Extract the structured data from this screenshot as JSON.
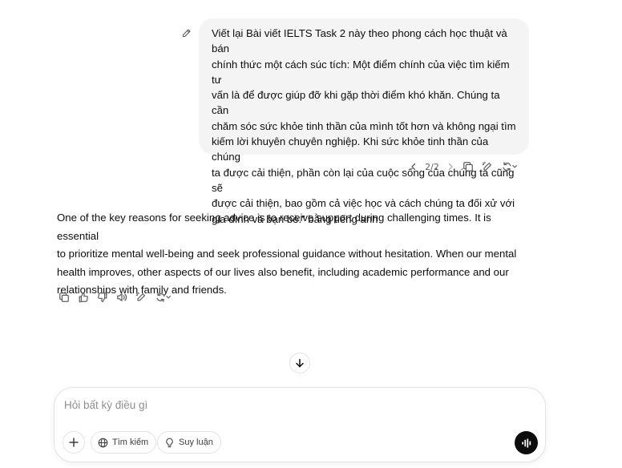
{
  "user_message": {
    "lines": [
      "Viết lại Bài viết IELTS Task 2 này theo phong cách học thuật và bán",
      "chính thức một cách súc tích: Một điểm chính của việc tìm kiếm tư",
      "vấn là để được giúp đỡ khi gặp thời điểm khó khăn. Chúng ta cần",
      "chăm sóc sức khỏe tinh thần của mình tốt hơn và không ngại tìm",
      "kiếm lời khuyên chuyên nghiệp. Khi sức khỏe tinh thần của chúng",
      "ta được cải thiện, phần còn lại của cuộc sống của chúng ta cũng sẽ",
      "được cải thiện, bao gồm cả việc học và cách chúng ta đối xử với",
      "gia đình và bạn bè.” bằng tiếng anh"
    ],
    "version": "2/2"
  },
  "assistant_message": {
    "lines": [
      "One of the key reasons for seeking advice is to receive support during challenging times. It is essential",
      "to prioritize mental well-being and seek professional guidance without hesitation. When our mental",
      "health improves, other aspects of our lives also benefit, including academic performance and our",
      "relationships with family and friends."
    ]
  },
  "composer": {
    "placeholder": "Hỏi bất kỳ điều gì",
    "search_label": "Tìm kiếm",
    "reason_label": "Suy luận"
  },
  "icons": {
    "edit": "pencil-icon",
    "prev": "chevron-left-icon",
    "next": "chevron-right-icon",
    "copy": "copy-icon",
    "edit_canvas": "edit-canvas-icon",
    "regenerate": "refresh-icon",
    "thumbs_up": "thumbs-up-icon",
    "thumbs_down": "thumbs-down-icon",
    "read_aloud": "speaker-icon",
    "scroll_down": "arrow-down-icon",
    "plus": "plus-icon",
    "globe": "globe-icon",
    "bulb": "lightbulb-icon",
    "voice": "voice-waveform-icon"
  },
  "colors": {
    "bubble_bg": "#f4f4f4",
    "text": "#0d0d0d",
    "muted": "#5d5d5d",
    "border": "#e3e3e3",
    "voice_btn": "#0d0d0d"
  }
}
